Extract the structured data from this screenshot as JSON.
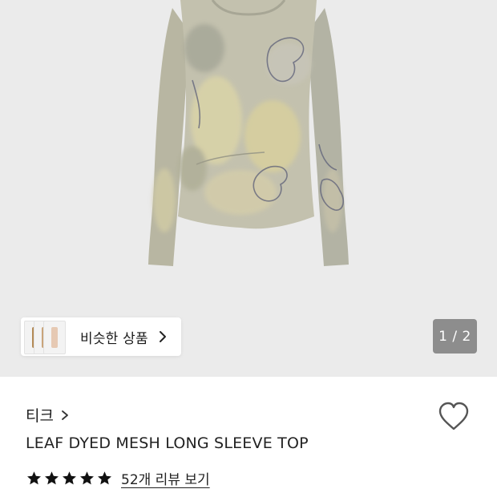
{
  "hero": {
    "image": "leaf-dyed-mesh-long-sleeve-top",
    "background_color": "#ebebeb",
    "page_indicator": "1 / 2"
  },
  "similar_products": {
    "label": "비슷한 상품",
    "chevron_icon": "chevron-right-icon"
  },
  "product": {
    "brand": "티크",
    "title": "LEAF DYED MESH LONG SLEEVE TOP",
    "rating_stars": 5,
    "review_link": "52개 리뷰 보기",
    "wishlist_icon": "heart-outline-icon"
  }
}
